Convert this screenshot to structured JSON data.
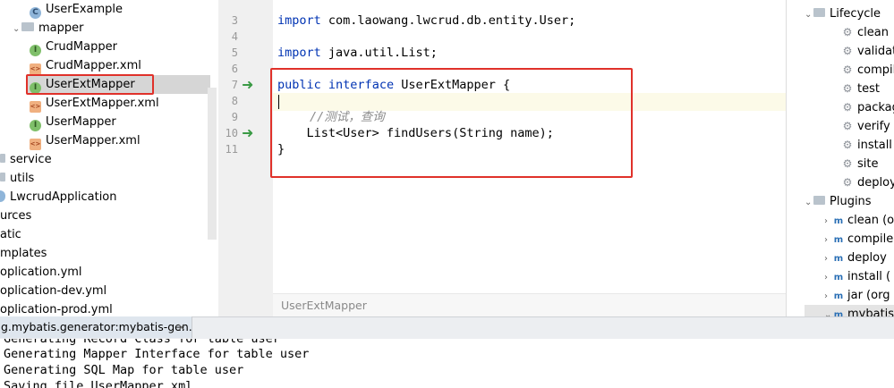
{
  "project_tree": {
    "items": [
      {
        "label": "UserExample",
        "icon": "class-icon"
      },
      {
        "label": "mapper",
        "icon": "folder-icon"
      },
      {
        "label": "CrudMapper",
        "icon": "interface-icon"
      },
      {
        "label": "CrudMapper.xml",
        "icon": "xml-file-icon"
      },
      {
        "label": "UserExtMapper",
        "icon": "interface-icon"
      },
      {
        "label": "UserExtMapper.xml",
        "icon": "xml-file-icon"
      },
      {
        "label": "UserMapper",
        "icon": "interface-icon"
      },
      {
        "label": "UserMapper.xml",
        "icon": "xml-file-icon"
      },
      {
        "label": "service",
        "icon": "folder-icon"
      },
      {
        "label": "utils",
        "icon": "folder-icon"
      },
      {
        "label": "LwcrudApplication",
        "icon": "class-icon"
      },
      {
        "label": "urces",
        "icon": ""
      },
      {
        "label": "atic",
        "icon": ""
      },
      {
        "label": "mplates",
        "icon": ""
      },
      {
        "label": "oplication.yml",
        "icon": ""
      },
      {
        "label": "oplication-dev.yml",
        "icon": ""
      },
      {
        "label": "oplication-prod.yml",
        "icon": ""
      }
    ]
  },
  "editor": {
    "line_numbers": [
      "3",
      "4",
      "5",
      "6",
      "7",
      "8",
      "9",
      "10",
      "11"
    ],
    "code": {
      "l3_kw": "import",
      "l3_rest": " com.laowang.lwcrud.db.entity.User;",
      "l5_kw": "import",
      "l5_rest": " java.util.List;",
      "l7_kw1": "public",
      "l7_kw2": "interface",
      "l7_rest": " UserExtMapper {",
      "l9_comment": "//测试，查询",
      "l10": "    List<User> findUsers(String name);",
      "l11": "}"
    },
    "breadcrumb": "UserExtMapper"
  },
  "maven": {
    "lifecycle_label": "Lifecycle",
    "lifecycle_items": [
      "clean",
      "validate",
      "compile",
      "test",
      "package",
      "verify",
      "install",
      "site",
      "deploy"
    ],
    "plugins_label": "Plugins",
    "plugin_items": [
      "clean (o",
      "compile",
      "deploy",
      "install (",
      "jar (org"
    ],
    "last_item": "mybatis"
  },
  "run": {
    "tab_label": "g.mybatis.generator:mybatis-gen...",
    "console_lines": [
      "Generating Record Class for table user",
      "Generating Mapper Interface for table user",
      "Generating SQL Map for table user",
      "Saving file UserMapper.xml"
    ]
  },
  "colors": {
    "highlight_box": "#e0312a",
    "keyword": "#0033b3",
    "gutter_icon": "#3a9a45"
  }
}
